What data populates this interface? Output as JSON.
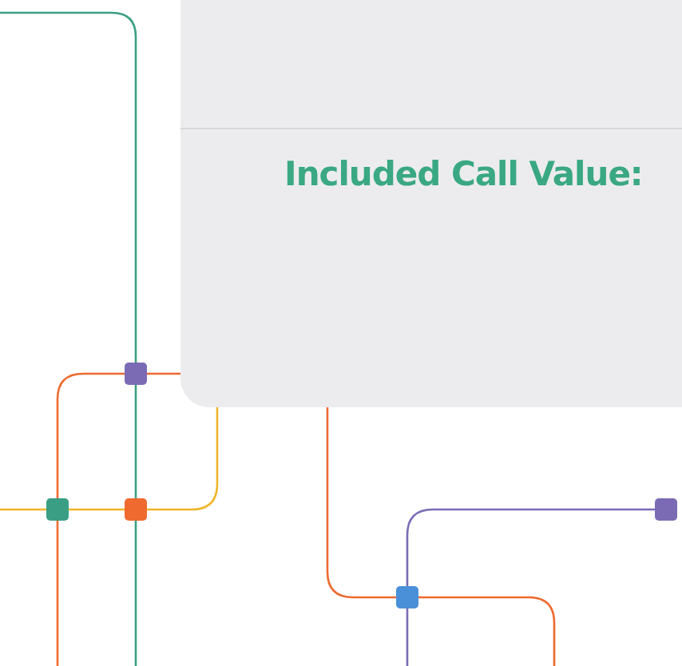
{
  "card": {
    "label": "Included Call Value:"
  }
}
